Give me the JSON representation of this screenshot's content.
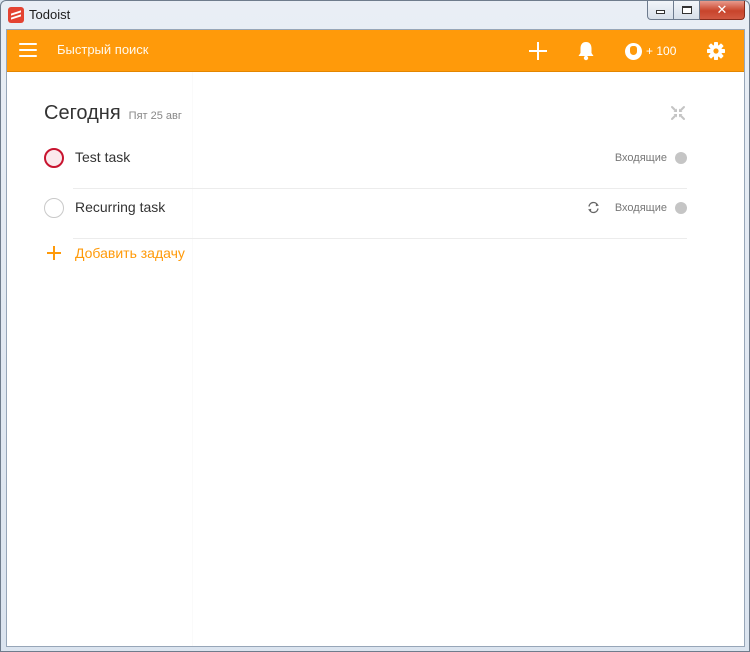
{
  "window": {
    "title": "Todoist",
    "controls": {
      "minimize": "minimize-icon",
      "maximize": "maximize-icon",
      "close": "✕"
    }
  },
  "topbar": {
    "background": "#ff9a0a",
    "menu_icon": "hamburger-icon",
    "search_placeholder": "Быстрый поиск",
    "add_icon": "plus-icon",
    "notifications_icon": "bell-icon",
    "karma": {
      "icon": "karma-icon",
      "text": "+ 100"
    },
    "settings_icon": "gear-icon"
  },
  "view": {
    "title": "Сегодня",
    "date": "Пят 25 авг",
    "collapse_icon": "collapse-icon"
  },
  "tasks": [
    {
      "content": "Test task",
      "priority": "p1",
      "priority_color": "#c8142f",
      "project": "Входящие",
      "recurring": false
    },
    {
      "content": "Recurring task",
      "priority": "p4",
      "project": "Входящие",
      "recurring": true,
      "recurring_icon": "repeat-icon"
    }
  ],
  "add_task": {
    "label": "Добавить задачу",
    "icon": "plus-icon",
    "color": "#ff9a0a"
  }
}
